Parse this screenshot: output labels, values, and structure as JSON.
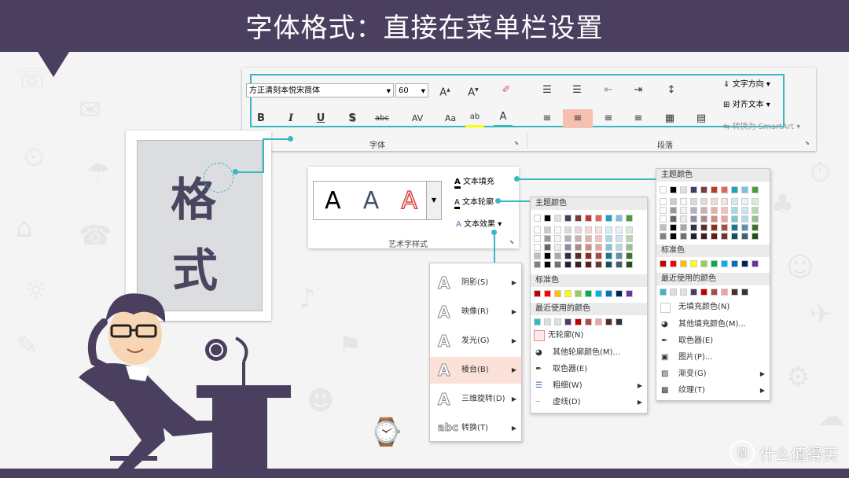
{
  "header": {
    "title": "字体格式：直接在菜单栏设置"
  },
  "watermark": {
    "text": "什么值得买",
    "icon": "值"
  },
  "ribbon": {
    "font_name": "方正清刻本悦宋简体",
    "font_size": "60",
    "font_row1_btns": [
      "A",
      "A"
    ],
    "font_row2_btns": [
      "B",
      "I",
      "U",
      "S",
      "abc",
      "AV",
      "Aa",
      "ab",
      "A"
    ],
    "font_group": "字体",
    "para_group": "段落",
    "text_direction": "文字方向",
    "align_text": "对齐文本",
    "smartart": "转换为 SmartArt"
  },
  "preview": {
    "char1": "格",
    "char2": "式"
  },
  "wordart": {
    "samples": [
      "A",
      "A",
      "A"
    ],
    "fill": "文本填充",
    "outline": "文本轮廓",
    "effects": "文本效果",
    "group": "艺术字样式"
  },
  "effects_menu": {
    "items": [
      "阴影(S)",
      "映像(R)",
      "发光(G)",
      "棱台(B)",
      "三维旋转(D)",
      "转换(T)"
    ]
  },
  "outline_menu": {
    "theme": "主题颜色",
    "standard": "标准色",
    "recent": "最近使用的颜色",
    "no_line": "无轮廓(N)",
    "more": "其他轮廓颜色(M)...",
    "picker": "取色器(E)",
    "weight": "粗细(W)",
    "dash": "虚线(D)"
  },
  "fill_menu": {
    "theme": "主题颜色",
    "standard": "标准色",
    "recent": "最近使用的颜色",
    "no_fill": "无填充颜色(N)",
    "more": "其他填充颜色(M)...",
    "picker": "取色器(E)",
    "picture": "图片(P)...",
    "gradient": "渐变(G)",
    "texture": "纹理(T)"
  },
  "colors": {
    "theme": [
      "#ffffff",
      "#000000",
      "#e7e6e6",
      "#44546a",
      "#4472c4",
      "#ed7d31",
      "#a5a5a5",
      "#ffc000",
      "#5b9bd5",
      "#70ad47"
    ],
    "theme_alt": [
      "#ffffff",
      "#000000",
      "#e0e0e0",
      "#3f3f5f",
      "#7a3b3b",
      "#c0392b",
      "#e8635a",
      "#1aa3c1",
      "#7fc0e0",
      "#4c9a3c"
    ],
    "standard": [
      "#c00000",
      "#ff0000",
      "#ffc000",
      "#ffff00",
      "#92d050",
      "#00b050",
      "#00b0f0",
      "#0070c0",
      "#002060",
      "#7030a0"
    ],
    "recent_outline": [
      "#3bb6c4",
      "#dddddd",
      "#e0e0e0",
      "#4a3f5e",
      "#c00000",
      "#b04848",
      "#f4a0a0",
      "#4a3020",
      "#333333"
    ],
    "recent_fill": [
      "#3bb6c4",
      "#dddddd",
      "#e0e0e0",
      "#4a3f5e",
      "#c00000",
      "#b04848",
      "#f4a0a0",
      "#4a3020",
      "#333333"
    ],
    "accent": "#3bb6c4"
  }
}
